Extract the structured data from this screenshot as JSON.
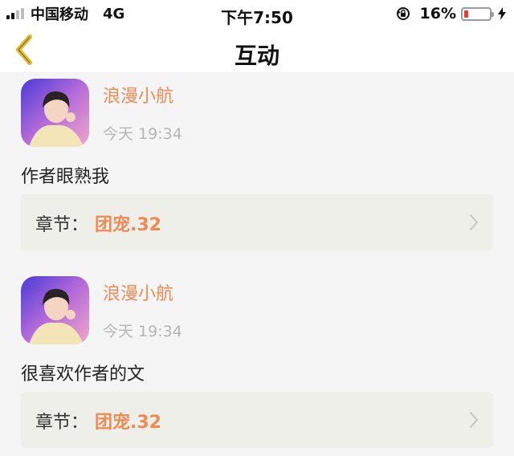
{
  "status_bar": {
    "carrier": "中国移动",
    "network": "4G",
    "time": "下午7:50",
    "battery_percent": "16%",
    "battery_level": 0.16,
    "icons": [
      "signal-icon",
      "rotation-lock-icon",
      "battery-icon",
      "charging-icon"
    ]
  },
  "nav": {
    "title": "互动",
    "back_icon": "chevron-left-icon",
    "accent_color": "#e5b930"
  },
  "colors": {
    "username": "#ee8a54",
    "chapter_name": "#ee8a54",
    "timestamp": "#b5b5b5",
    "chapter_box": "#efefe9",
    "background": "#f6f5f6"
  },
  "interactions": [
    {
      "username": "浪漫小航",
      "time": "今天 19:34",
      "comment": "作者眼熟我",
      "chapter_label": "章节：",
      "chapter_name": "团宠.32"
    },
    {
      "username": "浪漫小航",
      "time": "今天 19:34",
      "comment": "很喜欢作者的文",
      "chapter_label": "章节：",
      "chapter_name": "团宠.32"
    }
  ]
}
